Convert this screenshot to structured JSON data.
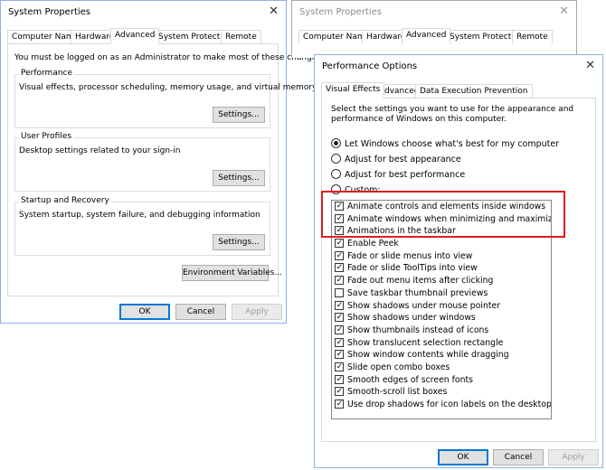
{
  "sys_props": {
    "title": "System Properties",
    "close_glyph": "✕",
    "tabs": [
      "Computer Name",
      "Hardware",
      "Advanced",
      "System Protection",
      "Remote"
    ],
    "active_tab": "Advanced",
    "admin_notice": "You must be logged on as an Administrator to make most of these changes.",
    "performance": {
      "label": "Performance",
      "desc": "Visual effects, processor scheduling, memory usage, and virtual memory",
      "button": "Settings..."
    },
    "user_profiles": {
      "label": "User Profiles",
      "desc": "Desktop settings related to your sign-in",
      "button": "Settings..."
    },
    "startup": {
      "label": "Startup and Recovery",
      "desc": "System startup, system failure, and debugging information",
      "button": "Settings..."
    },
    "env_button": "Environment Variables...",
    "ok": "OK",
    "cancel": "Cancel",
    "apply": "Apply"
  },
  "sys_props_back": {
    "title": "System Properties",
    "close_glyph": "✕",
    "tabs": [
      "Computer Name",
      "Hardware",
      "Advanced",
      "System Protection",
      "Remote"
    ]
  },
  "perf_options": {
    "title": "Performance Options",
    "close_glyph": "✕",
    "tabs": [
      "Visual Effects",
      "Advanced",
      "Data Execution Prevention"
    ],
    "active_tab": "Visual Effects",
    "intro_line1": "Select the settings you want to use for the appearance and",
    "intro_line2": "performance of Windows on this computer.",
    "radios": [
      {
        "label": "Let Windows choose what's best for my computer",
        "selected": true
      },
      {
        "label": "Adjust for best appearance",
        "selected": false
      },
      {
        "label": "Adjust for best performance",
        "selected": false
      },
      {
        "label": "Custom:",
        "selected": false
      }
    ],
    "effects": [
      {
        "label": "Animate controls and elements inside windows",
        "checked": true
      },
      {
        "label": "Animate windows when minimizing and maximizing",
        "checked": true
      },
      {
        "label": "Animations in the taskbar",
        "checked": true
      },
      {
        "label": "Enable Peek",
        "checked": true
      },
      {
        "label": "Fade or slide menus into view",
        "checked": true
      },
      {
        "label": "Fade or slide ToolTips into view",
        "checked": true
      },
      {
        "label": "Fade out menu items after clicking",
        "checked": true
      },
      {
        "label": "Save taskbar thumbnail previews",
        "checked": false
      },
      {
        "label": "Show shadows under mouse pointer",
        "checked": true
      },
      {
        "label": "Show shadows under windows",
        "checked": true
      },
      {
        "label": "Show thumbnails instead of icons",
        "checked": true
      },
      {
        "label": "Show translucent selection rectangle",
        "checked": true
      },
      {
        "label": "Show window contents while dragging",
        "checked": true
      },
      {
        "label": "Slide open combo boxes",
        "checked": true
      },
      {
        "label": "Smooth edges of screen fonts",
        "checked": true
      },
      {
        "label": "Smooth-scroll list boxes",
        "checked": true
      },
      {
        "label": "Use drop shadows for icon labels on the desktop",
        "checked": true
      }
    ],
    "ok": "OK",
    "cancel": "Cancel",
    "apply": "Apply"
  },
  "colors": {
    "accent_border": "#0078d7",
    "highlight": "#e21b22",
    "window_border": "#8db2e3"
  }
}
